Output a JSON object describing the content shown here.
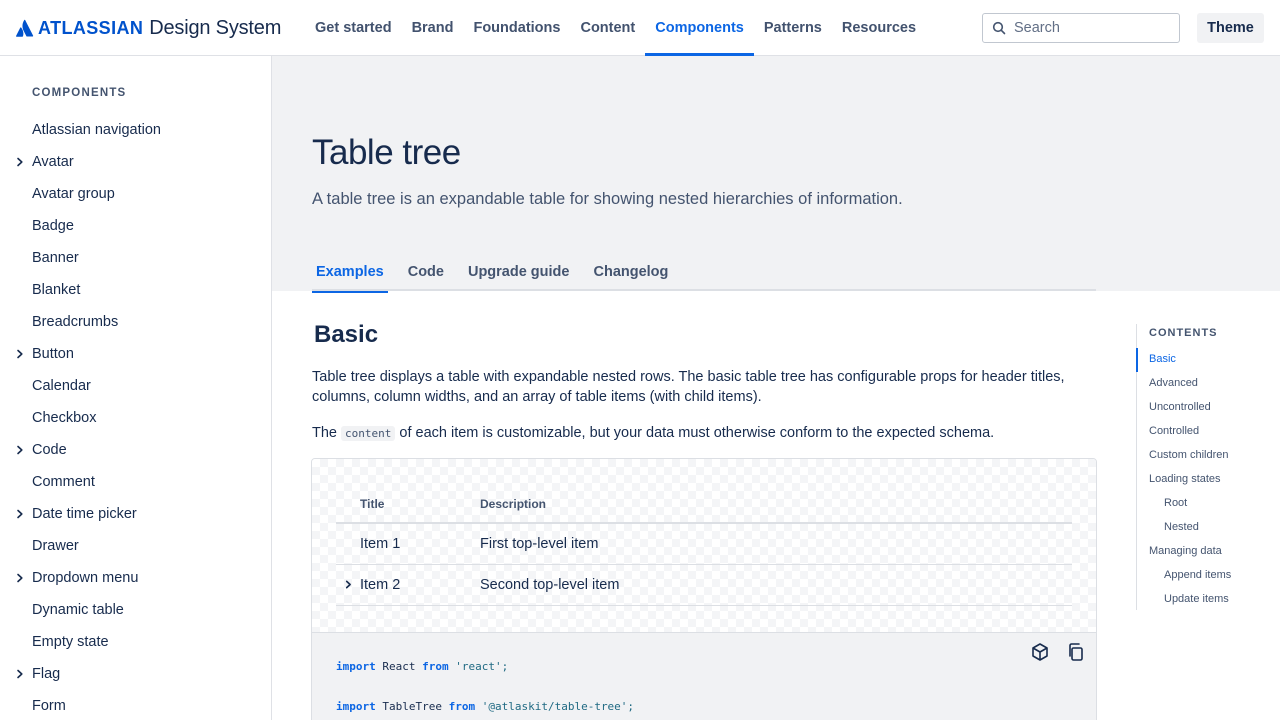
{
  "header": {
    "logo_word": "ATLASSIAN",
    "logo_product": "Design System",
    "nav": [
      "Get started",
      "Brand",
      "Foundations",
      "Content",
      "Components",
      "Patterns",
      "Resources"
    ],
    "active_nav": "Components",
    "search_placeholder": "Search",
    "theme_label": "Theme"
  },
  "sidebar": {
    "heading": "COMPONENTS",
    "items": [
      {
        "label": "Atlassian navigation",
        "expandable": false
      },
      {
        "label": "Avatar",
        "expandable": true
      },
      {
        "label": "Avatar group",
        "expandable": false
      },
      {
        "label": "Badge",
        "expandable": false
      },
      {
        "label": "Banner",
        "expandable": false
      },
      {
        "label": "Blanket",
        "expandable": false
      },
      {
        "label": "Breadcrumbs",
        "expandable": false
      },
      {
        "label": "Button",
        "expandable": true
      },
      {
        "label": "Calendar",
        "expandable": false
      },
      {
        "label": "Checkbox",
        "expandable": false
      },
      {
        "label": "Code",
        "expandable": true
      },
      {
        "label": "Comment",
        "expandable": false
      },
      {
        "label": "Date time picker",
        "expandable": true
      },
      {
        "label": "Drawer",
        "expandable": false
      },
      {
        "label": "Dropdown menu",
        "expandable": true
      },
      {
        "label": "Dynamic table",
        "expandable": false
      },
      {
        "label": "Empty state",
        "expandable": false
      },
      {
        "label": "Flag",
        "expandable": true
      },
      {
        "label": "Form",
        "expandable": false
      }
    ]
  },
  "page": {
    "title": "Table tree",
    "description": "A table tree is an expandable table for showing nested hierarchies of information.",
    "tabs": [
      "Examples",
      "Code",
      "Upgrade guide",
      "Changelog"
    ],
    "active_tab": "Examples"
  },
  "section": {
    "title": "Basic",
    "para1": "Table tree displays a table with expandable nested rows. The basic table tree has configurable props for header titles, columns, column widths, and an array of table items (with child items).",
    "para2_before": "The ",
    "para2_code": "content",
    "para2_after": " of each item is customizable, but your data must otherwise conform to the expected schema."
  },
  "example": {
    "headers": [
      "Title",
      "Description"
    ],
    "rows": [
      {
        "title": "Item 1",
        "description": "First top-level item",
        "expandable": false
      },
      {
        "title": "Item 2",
        "description": "Second top-level item",
        "expandable": true
      }
    ],
    "code": [
      {
        "kw": "import",
        "mid": " React ",
        "kw2": "from",
        "str": " 'react';"
      },
      {
        "kw": "import",
        "mid": " TableTree ",
        "kw2": "from",
        "str": " '@atlaskit/table-tree';"
      }
    ],
    "icons": [
      "sandbox-icon",
      "copy-icon"
    ]
  },
  "toc": {
    "heading": "CONTENTS",
    "items": [
      {
        "label": "Basic",
        "level": 1,
        "active": true
      },
      {
        "label": "Advanced",
        "level": 1
      },
      {
        "label": "Uncontrolled",
        "level": 1
      },
      {
        "label": "Controlled",
        "level": 1
      },
      {
        "label": "Custom children",
        "level": 1
      },
      {
        "label": "Loading states",
        "level": 1
      },
      {
        "label": "Root",
        "level": 2
      },
      {
        "label": "Nested",
        "level": 2
      },
      {
        "label": "Managing data",
        "level": 1
      },
      {
        "label": "Append items",
        "level": 2
      },
      {
        "label": "Update items",
        "level": 2
      }
    ]
  },
  "colors": {
    "brand_blue": "#0052cc",
    "link_blue": "#0c66e4",
    "text": "#172b4d",
    "subtle_text": "#44546f",
    "hero_bg": "#f1f2f4"
  }
}
